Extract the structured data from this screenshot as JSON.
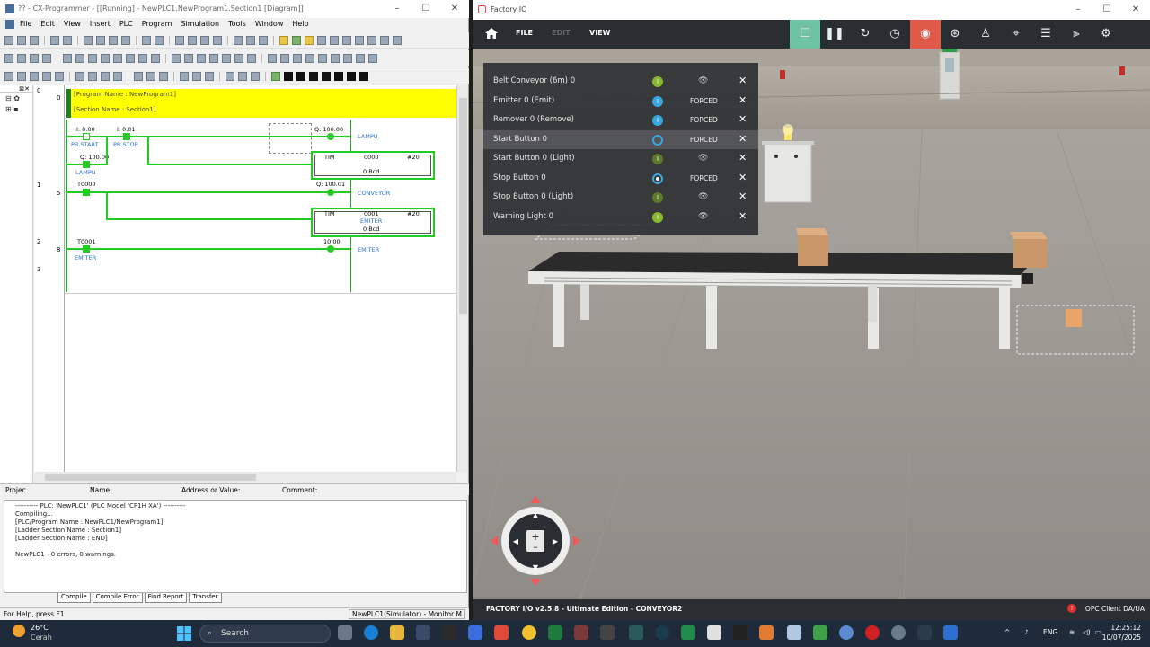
{
  "cx": {
    "title": "?? - CX-Programmer - [[Running] - NewPLC1.NewProgram1.Section1 [Diagram]]",
    "menu": [
      "File",
      "Edit",
      "View",
      "Insert",
      "PLC",
      "Program",
      "Simulation",
      "Tools",
      "Window",
      "Help"
    ],
    "ladder": {
      "program_name": "[Program Name : NewProgram1]",
      "section_name": "[Section Name : Section1]",
      "rungs": [
        {
          "rung": "0",
          "step": "0"
        },
        {
          "rung": "1",
          "step": "5"
        },
        {
          "rung": "2",
          "step": "8"
        },
        {
          "rung": "3",
          "step": ""
        }
      ],
      "addr_pb_start": "I: 0.00",
      "name_pb_start": "PB START",
      "addr_pb_stop": "I: 0.01",
      "name_pb_stop": "PB STOP",
      "addr_lampu_coil": "Q: 100.00",
      "name_lampu_coil": "LAMPU",
      "addr_lampu_contact": "Q: 100.00",
      "name_lampu_contact": "LAMPU",
      "tim1_label": "TIM",
      "tim1_num": "0000",
      "tim1_set": "#20",
      "tim1_val": "0 Bcd",
      "addr_t0000": "T0000",
      "addr_conveyor": "Q: 100.01",
      "name_conveyor": "CONVEYOR",
      "tim2_label": "TIM",
      "tim2_num": "0001",
      "tim2_name": "EMITER",
      "tim2_set": "#20",
      "tim2_val": "0 Bcd",
      "addr_t0001": "T0001",
      "name_t0001": "EMITER",
      "addr_emiter": "10.00",
      "name_emiter": "EMITER"
    },
    "watch": {
      "project_tab": "Projec",
      "name_label": "Name:",
      "addr_label": "Address or Value:",
      "comment_label": "Comment:"
    },
    "output_lines": [
      "---------- PLC: 'NewPLC1' (PLC Model 'CP1H XA') ----------",
      "Compiling...",
      "[PLC/Program Name : NewPLC1/NewProgram1]",
      "[Ladder Section Name : Section1]",
      "[Ladder Section Name : END]",
      "",
      "NewPLC1 - 0 errors, 0 warnings."
    ],
    "output_tabs": [
      "Compile",
      "Compile Error",
      "Find Report",
      "Transfer"
    ],
    "status_left": "For Help, press F1",
    "status_right": "NewPLC1(Simulator) - Monitor M"
  },
  "fio": {
    "title": "Factory IO",
    "menu_file": "FILE",
    "menu_edit": "EDIT",
    "menu_view": "VIEW",
    "toolbar_icons": [
      "stop-square-icon",
      "pause-icon",
      "reset-icon",
      "timer-icon",
      "camera-icon",
      "aperture-icon",
      "person-icon",
      "crosshair-icon",
      "list-icon",
      "sensor-icon",
      "settings-icon"
    ],
    "tags": [
      {
        "name": "Belt Conveyor (6m) 0",
        "ind": "green",
        "ind_text": "I",
        "forced": "",
        "eye": true
      },
      {
        "name": "Emitter 0 (Emit)",
        "ind": "blue",
        "ind_text": "I",
        "forced": "FORCED",
        "eye": false
      },
      {
        "name": "Remover 0 (Remove)",
        "ind": "blue",
        "ind_text": "I",
        "forced": "FORCED",
        "eye": false
      },
      {
        "name": "Start Button 0",
        "ind": "ring",
        "ind_text": "",
        "forced": "FORCED",
        "eye": false
      },
      {
        "name": "Start Button 0 (Light)",
        "ind": "dkgreen",
        "ind_text": "I",
        "forced": "",
        "eye": true
      },
      {
        "name": "Stop Button 0",
        "ind": "ring filled",
        "ind_text": "",
        "forced": "FORCED",
        "eye": false
      },
      {
        "name": "Stop Button 0 (Light)",
        "ind": "dkgreen",
        "ind_text": "I",
        "forced": "",
        "eye": true
      },
      {
        "name": "Warning Light 0",
        "ind": "green",
        "ind_text": "I",
        "forced": "",
        "eye": true
      }
    ],
    "version": "FACTORY I/O v2.5.8 - Ultimate Edition - CONVEYOR2",
    "opc": "OPC Client DA/UA"
  },
  "taskbar": {
    "temp": "26°C",
    "condition": "Cerah",
    "search": "Search",
    "lang": "ENG",
    "time": "12:25:12",
    "date": "10/07/2025"
  },
  "colors": {
    "rung_green": "#22cc22",
    "header_yellow": "#ffff00",
    "fio_dark": "#2a2d31",
    "fio_accent": "#6ec3a3"
  }
}
